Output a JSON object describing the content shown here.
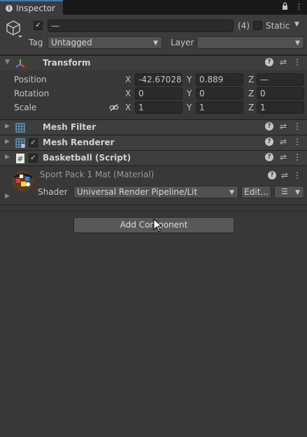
{
  "tab": {
    "title": "Inspector"
  },
  "header": {
    "name_value": "—",
    "count": "(4)",
    "static_label": "Static",
    "tag_label": "Tag",
    "tag_value": "Untagged",
    "layer_label": "Layer",
    "layer_value": ""
  },
  "transform": {
    "title": "Transform",
    "position_label": "Position",
    "rotation_label": "Rotation",
    "scale_label": "Scale",
    "x": "X",
    "y": "Y",
    "z": "Z",
    "position": {
      "x": "-42.67028",
      "y": "0.889",
      "z": "—"
    },
    "rotation": {
      "x": "0",
      "y": "0",
      "z": "0"
    },
    "scale": {
      "x": "1",
      "y": "1",
      "z": "1"
    }
  },
  "components": [
    {
      "title": "Mesh Filter",
      "icon": "mesh-filter-icon"
    },
    {
      "title": "Mesh Renderer",
      "icon": "mesh-renderer-icon"
    },
    {
      "title": "Basketball (Script)",
      "icon": "script-icon"
    }
  ],
  "material": {
    "title": "Sport Pack 1 Mat (Material)",
    "shader_label": "Shader",
    "shader_value": "Universal Render Pipeline/Lit",
    "edit_label": "Edit..."
  },
  "add_component": {
    "label": "Add Component"
  },
  "colors": {
    "background": "#383838",
    "tab_accent": "#3a79bb",
    "component_header": "#3e3e3e"
  }
}
